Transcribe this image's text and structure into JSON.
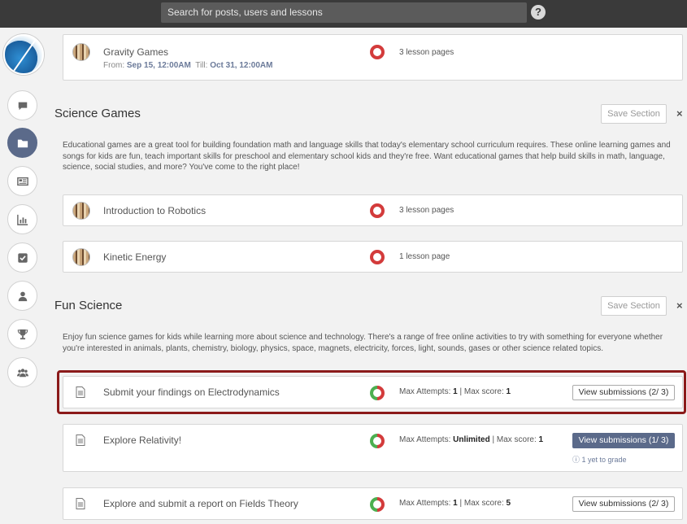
{
  "search": {
    "placeholder": "Search for posts, users and lessons"
  },
  "help_icon": "?",
  "sidebar": {
    "icons": [
      "chat-icon",
      "folder-icon",
      "newspaper-icon",
      "chart-icon",
      "checkbox-icon",
      "user-icon",
      "trophy-icon",
      "group-icon"
    ],
    "active": "folder-icon",
    "active_color": "#5b6a8a"
  },
  "top_item": {
    "title": "Gravity Games",
    "from_label": "From:",
    "from": "Sep 15, 12:00AM",
    "till_label": "Till:",
    "till": "Oct 31, 12:00AM",
    "pages": "3 lesson pages"
  },
  "sections": [
    {
      "title": "Science Games",
      "save_label": "Save Section",
      "close": "×",
      "description": "Educational games are a great tool for building foundation math and language skills that today's elementary school curriculum requires. These online learning games and songs for kids are fun, teach important skills for preschool and elementary school kids and they're free. Want educational games that help build skills in math, language, science, social studies, and more? You've come to the right place!",
      "items": [
        {
          "title": "Introduction to Robotics",
          "pages": "3 lesson pages"
        },
        {
          "title": "Kinetic Energy",
          "pages": "1 lesson page"
        }
      ]
    },
    {
      "title": "Fun Science",
      "save_label": "Save Section",
      "close": "×",
      "description": "Enjoy fun science games for kids while learning more about science and technology. There's a range of free online activities to try with something for everyone whether you're interested in animals, plants, chemistry, biology, physics, space, magnets, electricity, forces, light, sounds, gases or other science related topics.",
      "items": [
        {
          "title": "Submit your findings on Electrodynamics",
          "attempts_label": "Max Attempts:",
          "attempts": "1",
          "score_label": "Max score:",
          "score": "1",
          "button": "View submissions (2/ 3)",
          "highlighted": true
        },
        {
          "title": "Explore Relativity!",
          "attempts_label": "Max Attempts:",
          "attempts": "Unlimited",
          "score_label": "Max score:",
          "score": "1",
          "button": "View submissions (1/ 3)",
          "to_grade": "1 yet to grade"
        },
        {
          "title": "Explore and submit a report on Fields Theory",
          "attempts_label": "Max Attempts:",
          "attempts": "1",
          "score_label": "Max score:",
          "score": "5",
          "button": "View submissions (2/ 3)"
        }
      ]
    }
  ],
  "colors": {
    "status_red": "#d33b3b",
    "status_green": "#4caf50",
    "highlight": "#8b1a1a",
    "topbar": "#3a3a3a"
  }
}
